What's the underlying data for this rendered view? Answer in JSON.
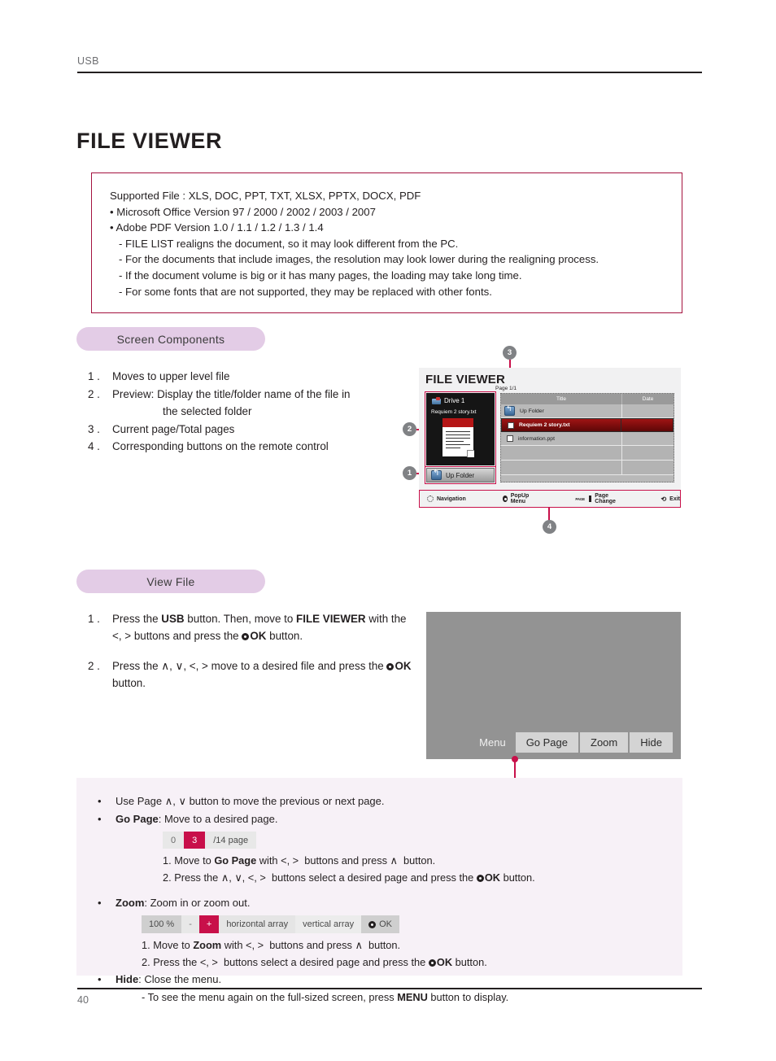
{
  "header": {
    "label": "USB",
    "title": "FILE VIEWER"
  },
  "spec_box": {
    "lines": [
      "Supported File : XLS, DOC, PPT, TXT, XLSX, PPTX, DOCX, PDF",
      "• Microsoft Office Version 97 / 2000 / 2002 / 2003 / 2007",
      "• Adobe PDF Version 1.0 / 1.1 / 1.2 / 1.3 / 1.4"
    ],
    "sub_lines": [
      "- FILE LIST realigns the document, so it may look different from the PC.",
      "- For the documents that include images, the resolution may look lower during the realigning process.",
      "- If the document volume is big or it has many pages, the loading may take long time.",
      "- For some fonts that are not supported, they may be replaced with other fonts."
    ]
  },
  "screen_components": {
    "pill": "Screen Components",
    "items": [
      {
        "n": "1 .",
        "text": "Moves to upper level file",
        "indent": ""
      },
      {
        "n": "2 .",
        "text": "Preview: Display the title/folder name of the file in",
        "indent": "the selected folder"
      },
      {
        "n": "3 .",
        "text": "Current page/Total pages",
        "indent": ""
      },
      {
        "n": "4 .",
        "text": "Corresponding buttons on the remote control",
        "indent": ""
      }
    ]
  },
  "mock": {
    "title": "FILE VIEWER",
    "page_indicator": "Page 1/1",
    "preview": {
      "drive": "Drive 1",
      "filename": "Requiem 2 story.txt"
    },
    "up_folder_button": "Up Folder",
    "list": {
      "columns": [
        "Title",
        "Date"
      ],
      "rows": [
        {
          "name": "Up Folder",
          "icon": "up-folder-icon",
          "selected": false,
          "date": ""
        },
        {
          "name": "Requiem 2 story.txt",
          "icon": "file-icon",
          "selected": true,
          "date": ""
        },
        {
          "name": "information.ppt",
          "icon": "file-icon",
          "selected": false,
          "date": ""
        }
      ]
    },
    "footer": [
      {
        "icon": "navigation-icon",
        "label": "Navigation"
      },
      {
        "icon": "ok-icon",
        "label": "PopUp Menu"
      },
      {
        "icon": "page-icon",
        "label": "Page  Change"
      },
      {
        "icon": "exit-icon",
        "label": "Exit"
      }
    ],
    "callouts": [
      "1",
      "2",
      "3",
      "4"
    ]
  },
  "view_file": {
    "pill": "View File",
    "steps": [
      {
        "n": "1 .",
        "parts": [
          "Press the ",
          "USB",
          " button. Then, move to ",
          "FILE VIEWER",
          " with the ",
          "<, >",
          " buttons and press the ",
          "OK",
          " button."
        ]
      },
      {
        "n": "2 .",
        "parts": [
          "Press the ",
          "∧, ∨, <, >",
          " move to a desired file and press the ",
          "OK",
          " button."
        ]
      }
    ]
  },
  "gray_screen": {
    "menu_label": "Menu",
    "buttons": [
      "Go Page",
      "Zoom",
      "Hide"
    ]
  },
  "notes": {
    "line1": "Use Page ∧, ∨ button to move the previous or next page.",
    "go_page": {
      "label": "Go Page",
      "desc": ": Move to a desired page.",
      "stepper": {
        "left": "0",
        "value": "3",
        "right": "/14 page"
      },
      "sub1": "1. Move to Go Page with <, >  buttons and press ∧  button.",
      "sub2": "2. Press the ∧, ∨, <, >  buttons select a desired page and press the OK button."
    },
    "zoom": {
      "label": "Zoom",
      "desc": ": Zoom in or zoom out.",
      "controls": {
        "percent": "100 %",
        "minus": "-",
        "plus": "+",
        "horizontal": "horizontal array",
        "vertical": "vertical array",
        "ok": "OK"
      },
      "sub1": "1. Move to Zoom with <, >  buttons and press ∧  button.",
      "sub2": "2. Press the <, >  buttons select a desired page and press the OK button."
    },
    "hide": {
      "label": "Hide",
      "desc": ": Close the menu.",
      "sub1": "- To see the menu again on the full-sized screen, press MENU button to display."
    }
  },
  "footer": {
    "page_number": "40"
  },
  "colors": {
    "accent": "#c8104a",
    "pill": "#e3cce6",
    "notes_bg": "#f7f1f7",
    "spec_border": "#a4123f"
  }
}
